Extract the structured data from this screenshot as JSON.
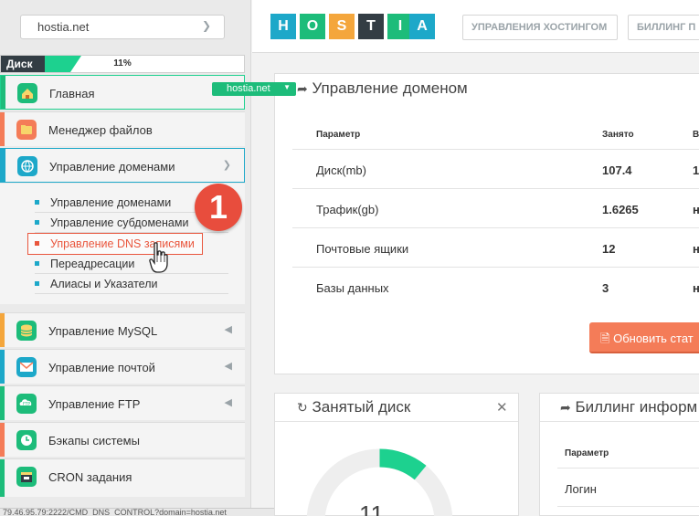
{
  "sidebar": {
    "domain_select": "hostia.net",
    "disk": {
      "label": "Диск",
      "percent_text": "11%",
      "percent": 11
    },
    "menu": [
      {
        "label": "Главная",
        "color": "#1dbc7a",
        "icon": "home-icon"
      },
      {
        "label": "Менеджер файлов",
        "color": "#f47c58",
        "icon": "folder-icon"
      },
      {
        "label": "Управление доменами",
        "color": "#1da8c9",
        "icon": "www-icon"
      },
      {
        "label": "Управление MySQL",
        "color": "#f4a63c",
        "icon": "database-icon"
      },
      {
        "label": "Управление почтой",
        "color": "#1da8c9",
        "icon": "mail-icon"
      },
      {
        "label": "Управление FTP",
        "color": "#1dbc7a",
        "icon": "ftp-icon"
      },
      {
        "label": "Бэкапы системы",
        "color": "#f47c58",
        "icon": "clock-icon"
      },
      {
        "label": "CRON задания",
        "color": "#1dbc7a",
        "icon": "cron-icon"
      }
    ],
    "submenu": [
      {
        "label": "Управление доменами"
      },
      {
        "label": "Управление субдоменами"
      },
      {
        "label": "Управление DNS записями"
      },
      {
        "label": "Переадресации"
      },
      {
        "label": "Алиасы и Указатели"
      }
    ],
    "step_badge": "1",
    "status_text": "79.46.95.79:2222/CMD_DNS_CONTROL?domain=hostia.net"
  },
  "header": {
    "logo_letters": [
      {
        "ch": "H",
        "color": "#1da8c9"
      },
      {
        "ch": "O",
        "color": "#1dbc7a"
      },
      {
        "ch": "S",
        "color": "#f4a63c"
      },
      {
        "ch": "T",
        "color": "#333d44"
      },
      {
        "ch": "I",
        "color": "#1dbc7a"
      },
      {
        "ch": "A",
        "color": "#1da8c9"
      }
    ],
    "buttons": [
      "УПРАВЛЕНИЯ ХОСТИНГОМ",
      "БИЛЛИНГ П"
    ]
  },
  "domain_panel": {
    "title": "Управление доменом",
    "domain_pill": "hostia.net",
    "columns": [
      "Параметр",
      "Занято",
      "В"
    ],
    "rows": [
      {
        "param": "Диск(mb)",
        "used": "107.4",
        "extra": "1"
      },
      {
        "param": "Трафик(gb)",
        "used": "1.6265",
        "extra": "н"
      },
      {
        "param": "Почтовые ящики",
        "used": "12",
        "extra": "н"
      },
      {
        "param": "Базы данных",
        "used": "3",
        "extra": "н"
      }
    ],
    "refresh_button": "Обновить стат"
  },
  "disk_panel": {
    "title": "Занятый диск",
    "close": "✕",
    "gauge_text": "11",
    "gauge_percent": 11
  },
  "billing_panel": {
    "title": "Биллинг информ",
    "columns": [
      "Параметр"
    ],
    "rows": [
      {
        "param": "Логин"
      }
    ]
  }
}
